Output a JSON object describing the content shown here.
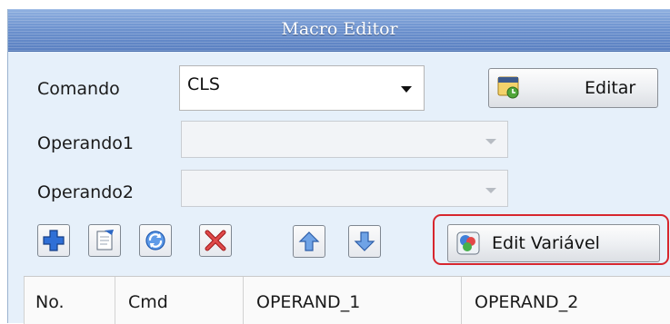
{
  "window": {
    "title": "Macro Editor"
  },
  "form": {
    "comando_label": "Comando",
    "comando_value": "CLS",
    "operando1_label": "Operando1",
    "operando1_value": "",
    "operando2_label": "Operando2",
    "operando2_value": ""
  },
  "buttons": {
    "editar_label": "Editar",
    "edit_variavel_label": "Edit Variável"
  },
  "toolbar": {
    "items": [
      "add-icon",
      "edit-document-icon",
      "refresh-icon",
      "delete-icon",
      "move-up-icon",
      "move-down-icon"
    ]
  },
  "table": {
    "columns": [
      "No.",
      "Cmd",
      "OPERAND_1",
      "OPERAND_2"
    ]
  },
  "colors": {
    "highlight": "#d7262e",
    "title_bar": "#6e93cf"
  }
}
